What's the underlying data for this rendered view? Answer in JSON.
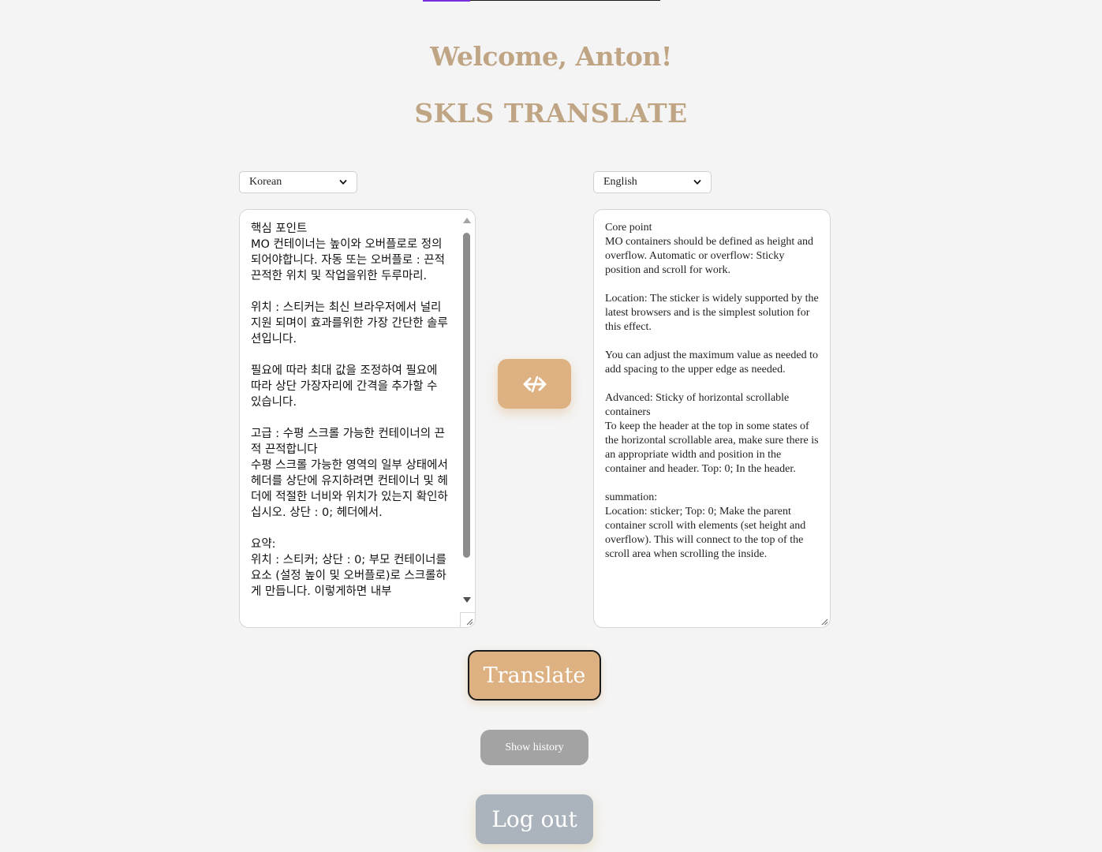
{
  "header": {
    "welcome": "Welcome, Anton!",
    "title": "SKLS TRANSLATE",
    "progress_fraction": 0.2
  },
  "source": {
    "language": "Korean",
    "text": "핵심 포인트\nMO 컨테이너는 높이와 오버플로로 정의되어야합니다. 자동 또는 오버플로 : 끈적 끈적한 위치 및 작업을위한 두루마리.\n\n위치 : 스티커는 최신 브라우저에서 널리 지원 되며이 효과를위한 가장 간단한 솔루션입니다.\n\n필요에 따라 최대 값을 조정하여 필요에 따라 상단 가장자리에 간격을 추가할 수 있습니다.\n\n고급 : 수평 스크롤 가능한 컨테이너의 끈적 끈적합니다\n수평 스크롤 가능한 영역의 일부 상태에서 헤더를 상단에 유지하려면 컨테이너 및 헤더에 적절한 너비와 위치가 있는지 확인하십시오. 상단 : 0; 헤더에서.\n\n요약:\n위치 : 스티커; 상단 : 0; 부모 컨테이너를 요소 (설정 높이 및 오버플로)로 스크롤하게 만듭니다. 이렇게하면 내부"
  },
  "target": {
    "language": "English",
    "text": "Core point\nMO containers should be defined as height and overflow. Automatic or overflow: Sticky position and scroll for work.\n\nLocation: The sticker is widely supported by the latest browsers and is the simplest solution for this effect.\n\nYou can adjust the maximum value as needed to add spacing to the upper edge as needed.\n\nAdvanced: Sticky of horizontal scrollable containers\nTo keep the header at the top in some states of the horizontal scrollable area, make sure there is an appropriate width and position in the container and header. Top: 0; In the header.\n\nsummation:\nLocation: sticker; Top: 0; Make the parent container scroll with elements (set height and overflow). This will connect to the top of the scroll area when scrolling the inside."
  },
  "buttons": {
    "swap_icon": "swap-arrows-icon",
    "translate": "Translate",
    "history": "Show history",
    "logout": "Log out"
  },
  "colors": {
    "accent": "#ddb181",
    "title": "#c0a584",
    "history": "#a3a3a3",
    "logout": "#abb4bc",
    "background": "#f4f4f4"
  }
}
